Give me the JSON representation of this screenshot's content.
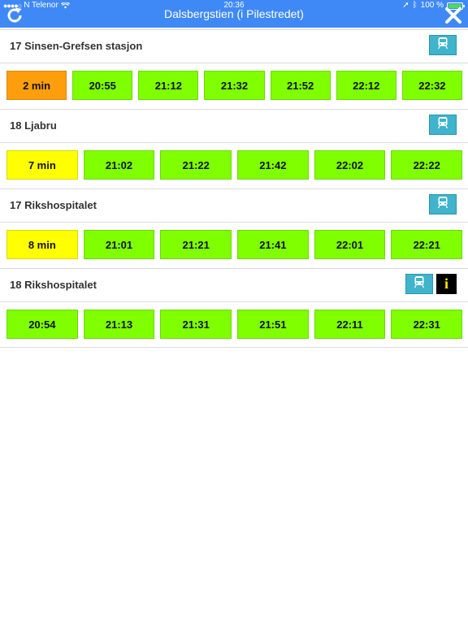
{
  "status": {
    "carrier": "N Telenor",
    "time": "20:36",
    "battery": "100 %"
  },
  "header": {
    "title": "Dalsbergstien (i Pilestredet)"
  },
  "sections": [
    {
      "route": "17 Sinsen-Grefsen stasjon",
      "times": [
        {
          "label": "2 min",
          "color": "orange"
        },
        {
          "label": "20:55",
          "color": "green"
        },
        {
          "label": "21:12",
          "color": "green"
        },
        {
          "label": "21:32",
          "color": "green"
        },
        {
          "label": "21:52",
          "color": "green"
        },
        {
          "label": "22:12",
          "color": "green"
        },
        {
          "label": "22:32",
          "color": "green"
        }
      ]
    },
    {
      "route": "18 Ljabru",
      "times": [
        {
          "label": "7 min",
          "color": "yellow"
        },
        {
          "label": "21:02",
          "color": "green"
        },
        {
          "label": "21:22",
          "color": "green"
        },
        {
          "label": "21:42",
          "color": "green"
        },
        {
          "label": "22:02",
          "color": "green"
        },
        {
          "label": "22:22",
          "color": "green"
        }
      ]
    },
    {
      "route": "17 Rikshospitalet",
      "times": [
        {
          "label": "8 min",
          "color": "yellow"
        },
        {
          "label": "21:01",
          "color": "green"
        },
        {
          "label": "21:21",
          "color": "green"
        },
        {
          "label": "21:41",
          "color": "green"
        },
        {
          "label": "22:01",
          "color": "green"
        },
        {
          "label": "22:21",
          "color": "green"
        }
      ]
    },
    {
      "route": "18 Rikshospitalet",
      "info": "i",
      "times": [
        {
          "label": "20:54",
          "color": "green"
        },
        {
          "label": "21:13",
          "color": "green"
        },
        {
          "label": "21:31",
          "color": "green"
        },
        {
          "label": "21:51",
          "color": "green"
        },
        {
          "label": "22:11",
          "color": "green"
        },
        {
          "label": "22:31",
          "color": "green"
        }
      ]
    }
  ],
  "colors": {
    "bar": "#3f89f7",
    "green": "#7fff00",
    "orange": "#ff9e0c",
    "yellow": "#ffff00",
    "tram": "#3fb4cc"
  }
}
